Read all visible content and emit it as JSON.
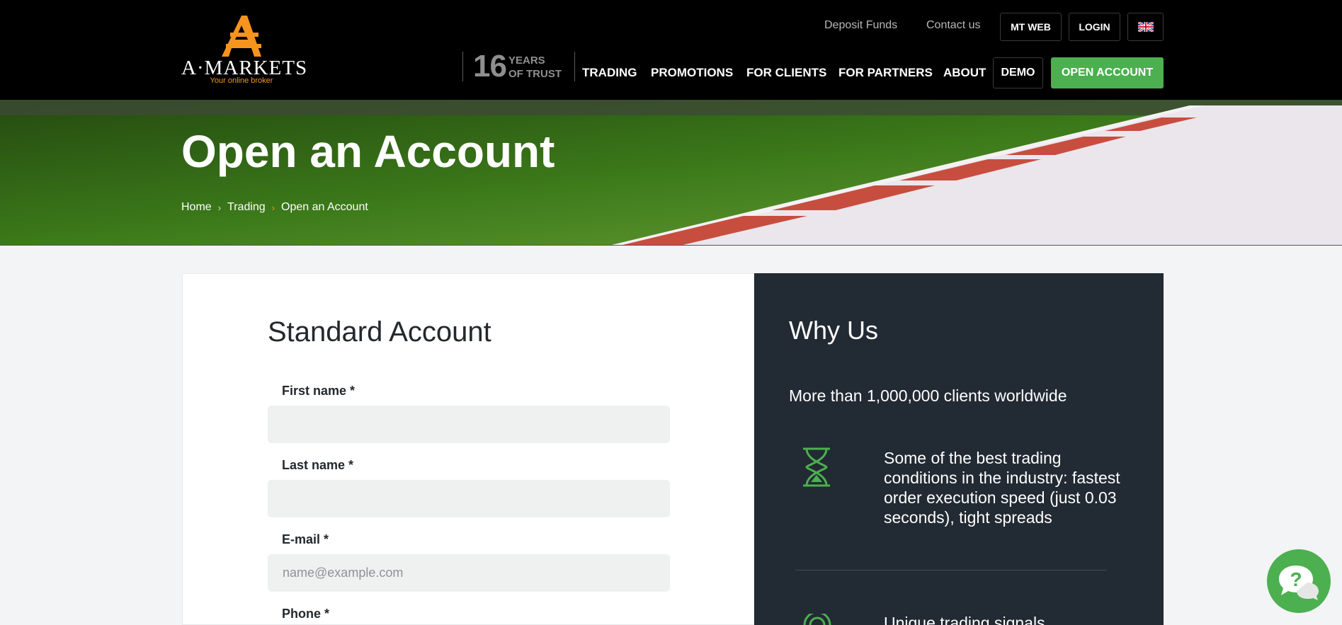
{
  "header": {
    "logo_text": "A·MARKETS",
    "logo_tagline": "Your online broker",
    "top_links": [
      "Deposit Funds",
      "Contact us"
    ],
    "mt_web": "MT WEB",
    "login": "LOGIN",
    "language_icon": "uk-flag-icon",
    "years_number": "16",
    "years_line1": "YEARS",
    "years_line2": "OF TRUST",
    "nav": [
      "TRADING",
      "PROMOTIONS",
      "FOR CLIENTS",
      "FOR PARTNERS",
      "ABOUT"
    ],
    "demo": "DEMO",
    "open_account": "OPEN ACCOUNT"
  },
  "hero": {
    "title": "Open an Account",
    "breadcrumb": [
      "Home",
      "Trading",
      "Open an Account"
    ]
  },
  "form": {
    "title": "Standard Account",
    "fields": [
      {
        "label": "First name *",
        "placeholder": ""
      },
      {
        "label": "Last name *",
        "placeholder": ""
      },
      {
        "label": "E-mail *",
        "placeholder": "name@example.com"
      },
      {
        "label": "Phone *",
        "placeholder": ""
      }
    ]
  },
  "why": {
    "title": "Why Us",
    "clients": "More than 1,000,000 clients worldwide",
    "benefits": [
      {
        "icon": "hourglass-icon",
        "text": "Some of the best trading conditions in the industry: fastest order execution speed (just 0.03 seconds), tight spreads"
      },
      {
        "icon": "signal-icon",
        "text": "Unique trading signals"
      }
    ]
  },
  "help": {
    "icon": "help-chat-icon"
  },
  "colors": {
    "accent": "#4caf50",
    "brand_orange": "#f7941d",
    "dark_panel": "#222a33"
  }
}
